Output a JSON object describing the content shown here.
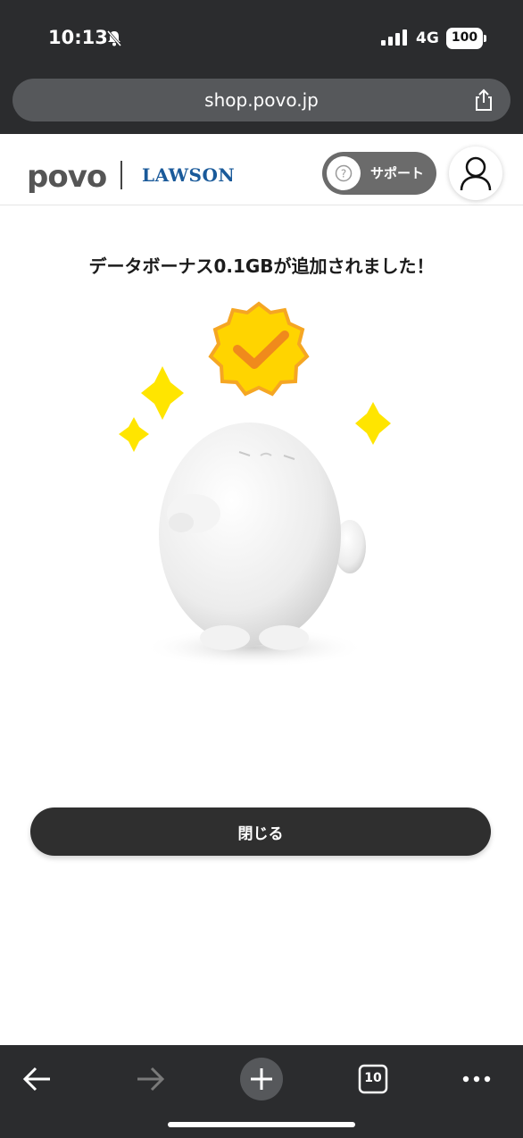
{
  "status_bar": {
    "time": "10:13",
    "network": "4G",
    "battery": "100"
  },
  "browser": {
    "url": "shop.povo.jp",
    "tab_count": "10"
  },
  "header": {
    "logo_povo": "povo",
    "logo_lawson": "LAWSON",
    "support_label": "サポート"
  },
  "main": {
    "message": "データボーナス0.1GBが追加されました！",
    "close_label": "閉じる"
  },
  "colors": {
    "chrome": "#2b2c2e",
    "badge": "#ffd400",
    "check": "#f08a1c",
    "button": "#2f2f2f"
  },
  "icons": [
    "bell-muted-icon",
    "signal-icon",
    "share-icon",
    "help-icon",
    "user-icon",
    "back-arrow-icon",
    "forward-arrow-icon",
    "new-tab-icon",
    "tabs-icon",
    "more-icon"
  ]
}
